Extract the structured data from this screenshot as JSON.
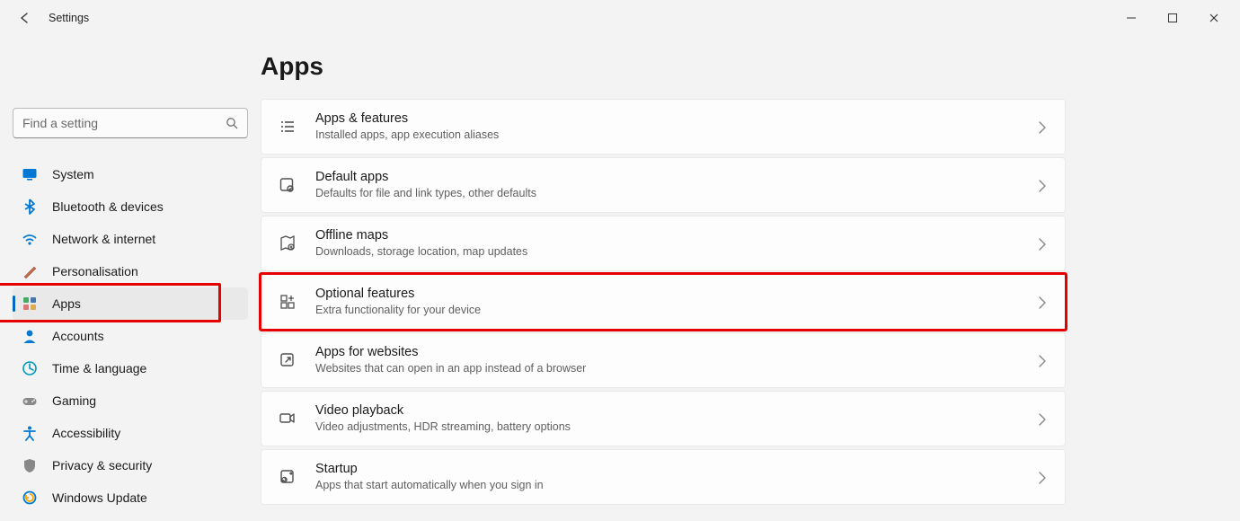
{
  "app_title": "Settings",
  "search": {
    "placeholder": "Find a setting"
  },
  "page_heading": "Apps",
  "sidebar": {
    "items": [
      {
        "label": "System",
        "icon": "display",
        "selected": false
      },
      {
        "label": "Bluetooth & devices",
        "icon": "bluetooth",
        "selected": false
      },
      {
        "label": "Network & internet",
        "icon": "wifi",
        "selected": false
      },
      {
        "label": "Personalisation",
        "icon": "brush",
        "selected": false
      },
      {
        "label": "Apps",
        "icon": "apps",
        "selected": true
      },
      {
        "label": "Accounts",
        "icon": "person",
        "selected": false
      },
      {
        "label": "Time & language",
        "icon": "clock-globe",
        "selected": false
      },
      {
        "label": "Gaming",
        "icon": "gamepad",
        "selected": false
      },
      {
        "label": "Accessibility",
        "icon": "accessibility",
        "selected": false
      },
      {
        "label": "Privacy & security",
        "icon": "shield",
        "selected": false
      },
      {
        "label": "Windows Update",
        "icon": "update",
        "selected": false
      }
    ]
  },
  "cards": [
    {
      "title": "Apps & features",
      "sub": "Installed apps, app execution aliases",
      "icon": "list"
    },
    {
      "title": "Default apps",
      "sub": "Defaults for file and link types, other defaults",
      "icon": "default-apps"
    },
    {
      "title": "Offline maps",
      "sub": "Downloads, storage location, map updates",
      "icon": "map"
    },
    {
      "title": "Optional features",
      "sub": "Extra functionality for your device",
      "icon": "puzzle",
      "highlight": true
    },
    {
      "title": "Apps for websites",
      "sub": "Websites that can open in an app instead of a browser",
      "icon": "open-external"
    },
    {
      "title": "Video playback",
      "sub": "Video adjustments, HDR streaming, battery options",
      "icon": "video"
    },
    {
      "title": "Startup",
      "sub": "Apps that start automatically when you sign in",
      "icon": "startup"
    }
  ],
  "highlight_color": "#e60000"
}
